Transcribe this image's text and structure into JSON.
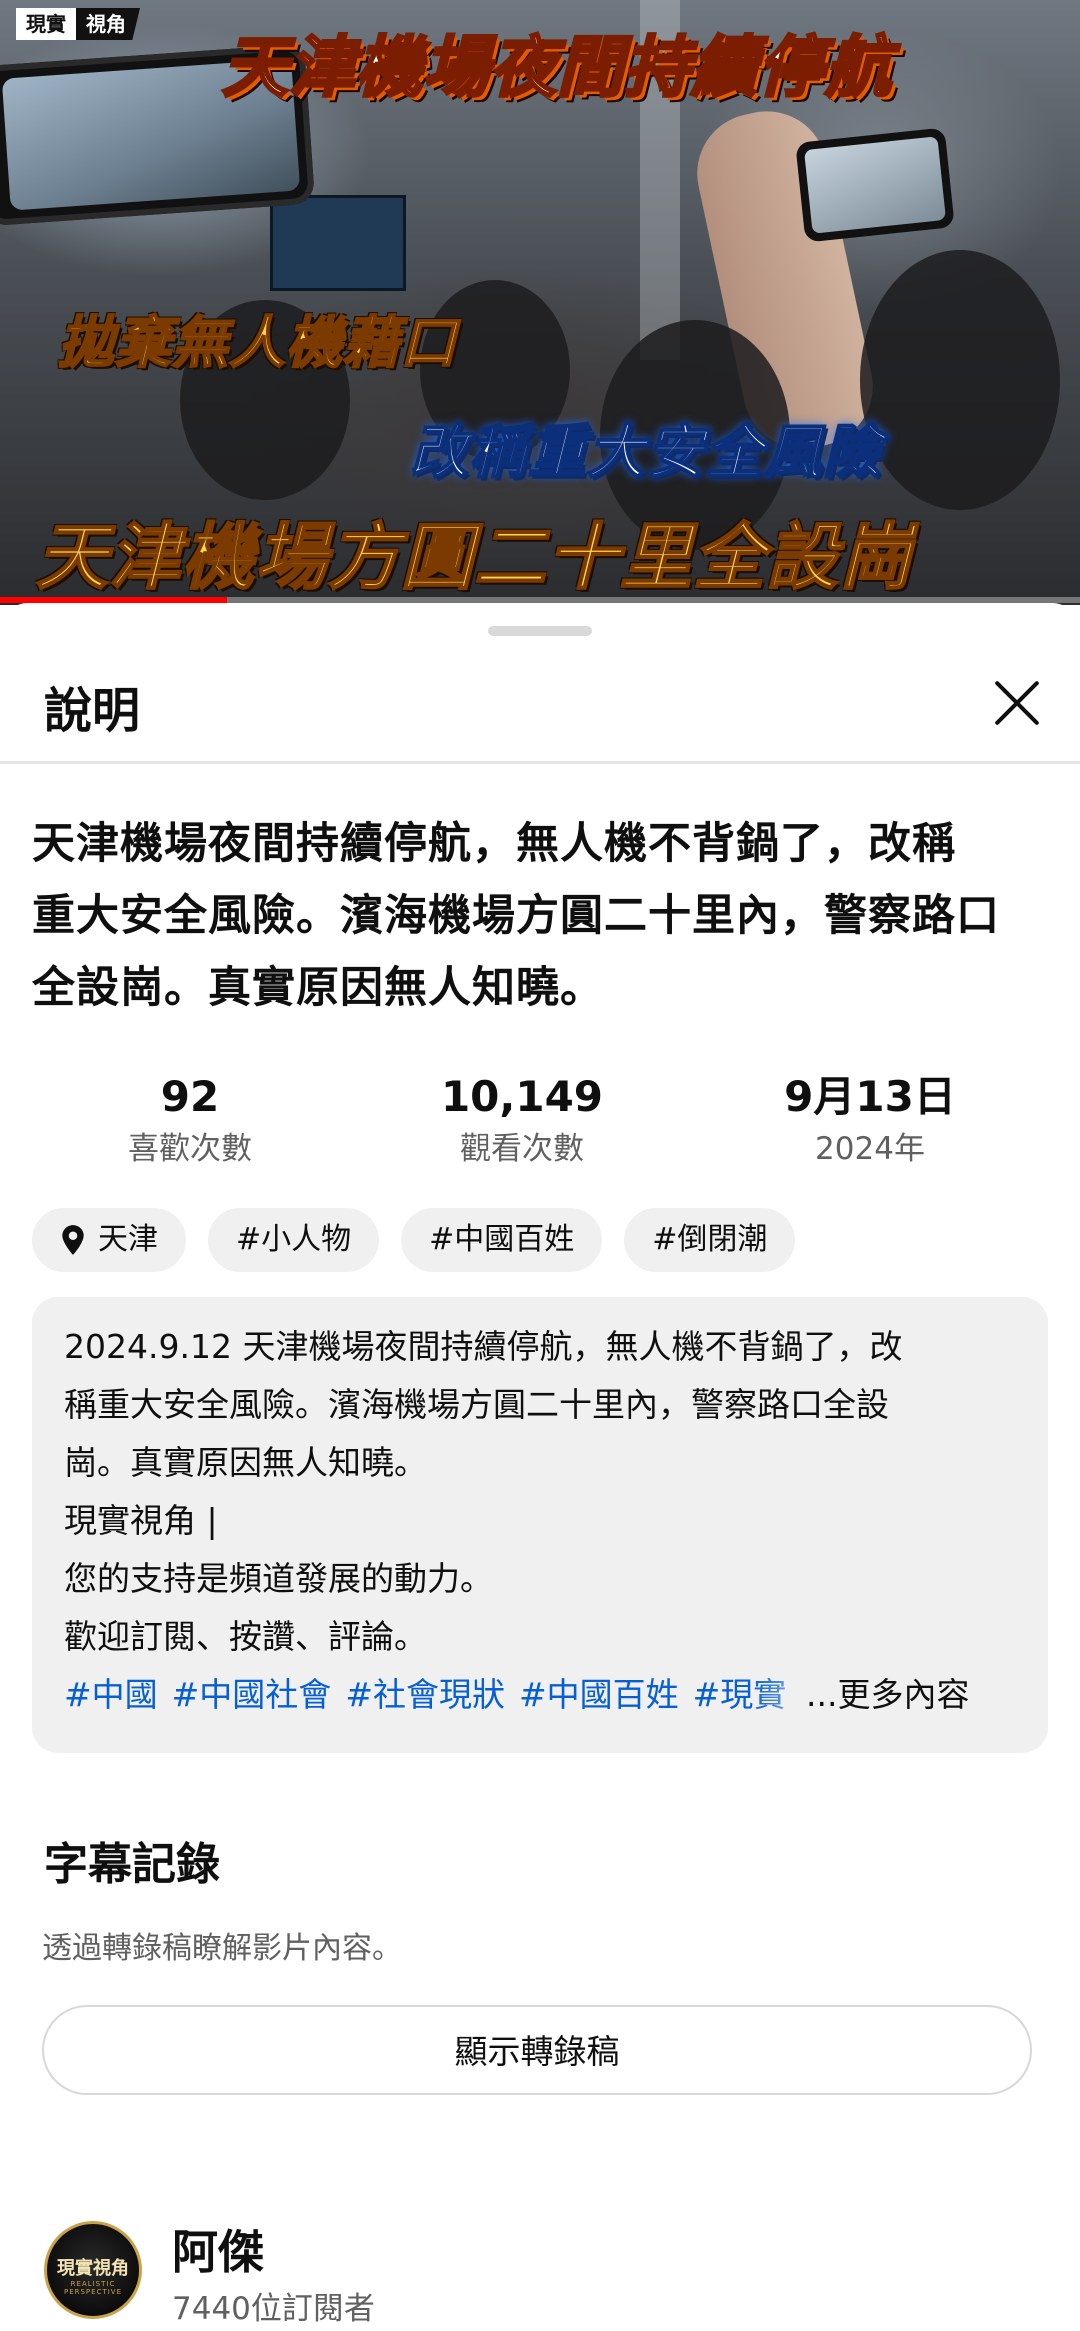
{
  "video": {
    "channel_badge_left": "現實",
    "channel_badge_right": "視角",
    "caption_top": "天津機場夜間持續停航",
    "caption_left": "拋棄無人機藉口",
    "caption_blue": "改稱重大安全風險",
    "caption_bottom": "天津機場方圓二十里全設崗",
    "progress_fraction": 0.21
  },
  "sheet": {
    "title": "說明",
    "close_icon": "close-icon",
    "video_title_lines": [
      "天津機場夜間持續停航，無人機不背鍋了，改稱",
      "重大安全風險。濱海機場方圓二十里內，警察路口",
      "全設崗。真實原因無人知曉。"
    ],
    "stats": [
      {
        "value": "92",
        "label": "喜歡次數"
      },
      {
        "value": "10,149",
        "label": "觀看次數"
      },
      {
        "value": "9月13日",
        "label": "2024年"
      }
    ],
    "chips": {
      "location": "天津",
      "location_icon": "map-pin-icon",
      "tags": [
        "#小人物",
        "#中國百姓",
        "#倒閉潮"
      ]
    },
    "description": {
      "lines": [
        "2024.9.12 天津機場夜間持續停航，無人機不背鍋了，改",
        "稱重大安全風險。濱海機場方圓二十里內，警察路口全設",
        "崗。真實原因無人知曉。",
        "現實視角 |",
        "您的支持是頻道發展的動力。",
        "歡迎訂閱、按讚、評論。"
      ],
      "hashtags": [
        "#中國",
        "#中國社會",
        "#社會現狀",
        "#中國百姓",
        "#現實"
      ],
      "more_label": "...更多內容"
    },
    "transcript": {
      "title": "字幕記錄",
      "subtitle": "透過轉錄稿瞭解影片內容。",
      "button_label": "顯示轉錄稿"
    },
    "channel": {
      "avatar_text": "現實視角",
      "avatar_sub": "REALISTIC PERSPECTIVE",
      "name": "阿傑",
      "subscribers": "7440位訂閱者"
    }
  },
  "colors": {
    "progress_red": "#ff0000",
    "hashtag_blue": "#065fd4",
    "secondary_text": "#606060"
  }
}
